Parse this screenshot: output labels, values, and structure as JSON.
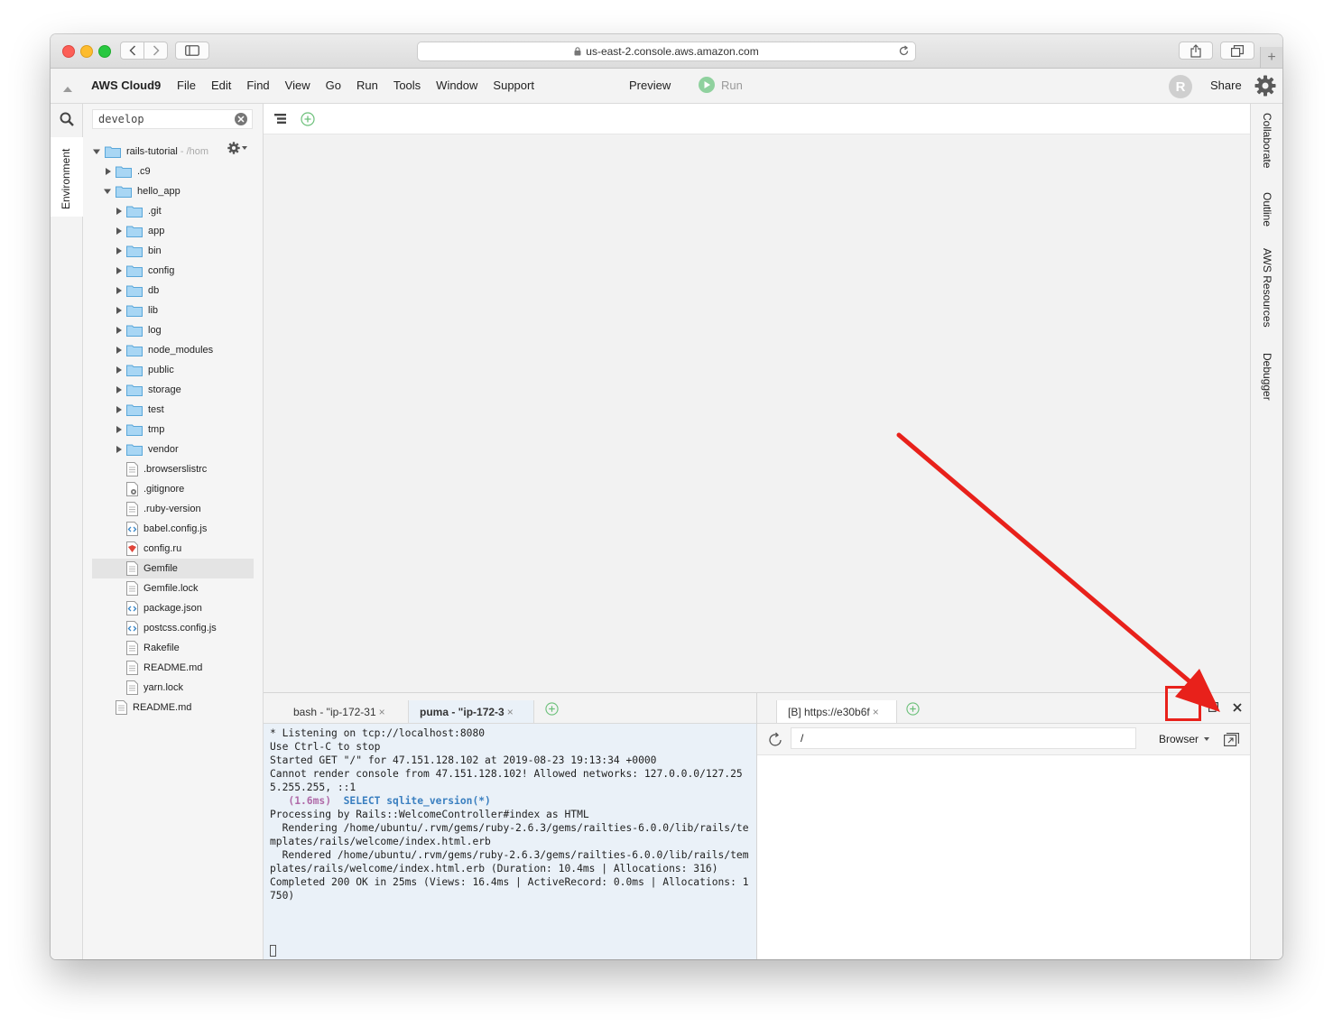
{
  "browser": {
    "url": "us-east-2.console.aws.amazon.com"
  },
  "menubar": {
    "brand": "AWS Cloud9",
    "items": [
      "File",
      "Edit",
      "Find",
      "View",
      "Go",
      "Run",
      "Tools",
      "Window",
      "Support"
    ],
    "preview": "Preview",
    "run": "Run",
    "avatar_initial": "R",
    "share": "Share"
  },
  "left_rail": {
    "environment_tab": "Environment"
  },
  "search": {
    "value": "develop"
  },
  "file_tree": {
    "root": {
      "name": "rails-tutorial",
      "path_hint": "- /hom"
    },
    "rows": [
      {
        "name": ".c9",
        "type": "folder",
        "depth": 1,
        "expanded": false
      },
      {
        "name": "hello_app",
        "type": "folder",
        "depth": 1,
        "expanded": true
      },
      {
        "name": ".git",
        "type": "folder",
        "depth": 2,
        "expanded": false
      },
      {
        "name": "app",
        "type": "folder",
        "depth": 2,
        "expanded": false
      },
      {
        "name": "bin",
        "type": "folder",
        "depth": 2,
        "expanded": false
      },
      {
        "name": "config",
        "type": "folder",
        "depth": 2,
        "expanded": false
      },
      {
        "name": "db",
        "type": "folder",
        "depth": 2,
        "expanded": false
      },
      {
        "name": "lib",
        "type": "folder",
        "depth": 2,
        "expanded": false
      },
      {
        "name": "log",
        "type": "folder",
        "depth": 2,
        "expanded": false
      },
      {
        "name": "node_modules",
        "type": "folder",
        "depth": 2,
        "expanded": false
      },
      {
        "name": "public",
        "type": "folder",
        "depth": 2,
        "expanded": false
      },
      {
        "name": "storage",
        "type": "folder",
        "depth": 2,
        "expanded": false
      },
      {
        "name": "test",
        "type": "folder",
        "depth": 2,
        "expanded": false
      },
      {
        "name": "tmp",
        "type": "folder",
        "depth": 2,
        "expanded": false
      },
      {
        "name": "vendor",
        "type": "folder",
        "depth": 2,
        "expanded": false
      },
      {
        "name": ".browserslistrc",
        "type": "file",
        "depth": 2
      },
      {
        "name": ".gitignore",
        "type": "file-gear",
        "depth": 2
      },
      {
        "name": ".ruby-version",
        "type": "file",
        "depth": 2
      },
      {
        "name": "babel.config.js",
        "type": "file-code",
        "depth": 2
      },
      {
        "name": "config.ru",
        "type": "file-ruby",
        "depth": 2
      },
      {
        "name": "Gemfile",
        "type": "file",
        "depth": 2,
        "selected": true
      },
      {
        "name": "Gemfile.lock",
        "type": "file",
        "depth": 2
      },
      {
        "name": "package.json",
        "type": "file-code",
        "depth": 2
      },
      {
        "name": "postcss.config.js",
        "type": "file-code",
        "depth": 2
      },
      {
        "name": "Rakefile",
        "type": "file",
        "depth": 2
      },
      {
        "name": "README.md",
        "type": "file",
        "depth": 2
      },
      {
        "name": "yarn.lock",
        "type": "file",
        "depth": 2
      },
      {
        "name": "README.md",
        "type": "file",
        "depth": 1
      }
    ]
  },
  "right_rail": {
    "tabs": [
      "Collaborate",
      "Outline",
      "AWS Resources",
      "Debugger"
    ]
  },
  "terminal": {
    "tabs": [
      {
        "label": "bash - \"ip-172-31",
        "active": false
      },
      {
        "label": "puma - \"ip-172-3",
        "active": true
      }
    ],
    "lines": [
      {
        "text": "* Listening on tcp://localhost:8080"
      },
      {
        "text": "Use Ctrl-C to stop"
      },
      {
        "text": "Started GET \"/\" for 47.151.128.102 at 2019-08-23 19:13:34 +0000"
      },
      {
        "text": "Cannot render console from 47.151.128.102! Allowed networks: 127.0.0.0/127.255.255.255, ::1"
      },
      {
        "sql_time": "   (1.6ms)",
        "sql_stmt": "  SELECT sqlite_version(*)"
      },
      {
        "text": "Processing by Rails::WelcomeController#index as HTML"
      },
      {
        "text": "  Rendering /home/ubuntu/.rvm/gems/ruby-2.6.3/gems/railties-6.0.0/lib/rails/templates/rails/welcome/index.html.erb"
      },
      {
        "text": "  Rendered /home/ubuntu/.rvm/gems/ruby-2.6.3/gems/railties-6.0.0/lib/rails/templates/rails/welcome/index.html.erb (Duration: 10.4ms | Allocations: 316)"
      },
      {
        "text": "Completed 200 OK in 25ms (Views: 16.4ms | ActiveRecord: 0.0ms | Allocations: 1750)"
      }
    ]
  },
  "preview_browser": {
    "tab_label": "[B] https://e30b6f",
    "path": "/",
    "mode": "Browser"
  },
  "colors": {
    "annotation_red": "#e8211b",
    "folder_blue": "#7fc3ee",
    "run_green": "#8fd19e"
  }
}
